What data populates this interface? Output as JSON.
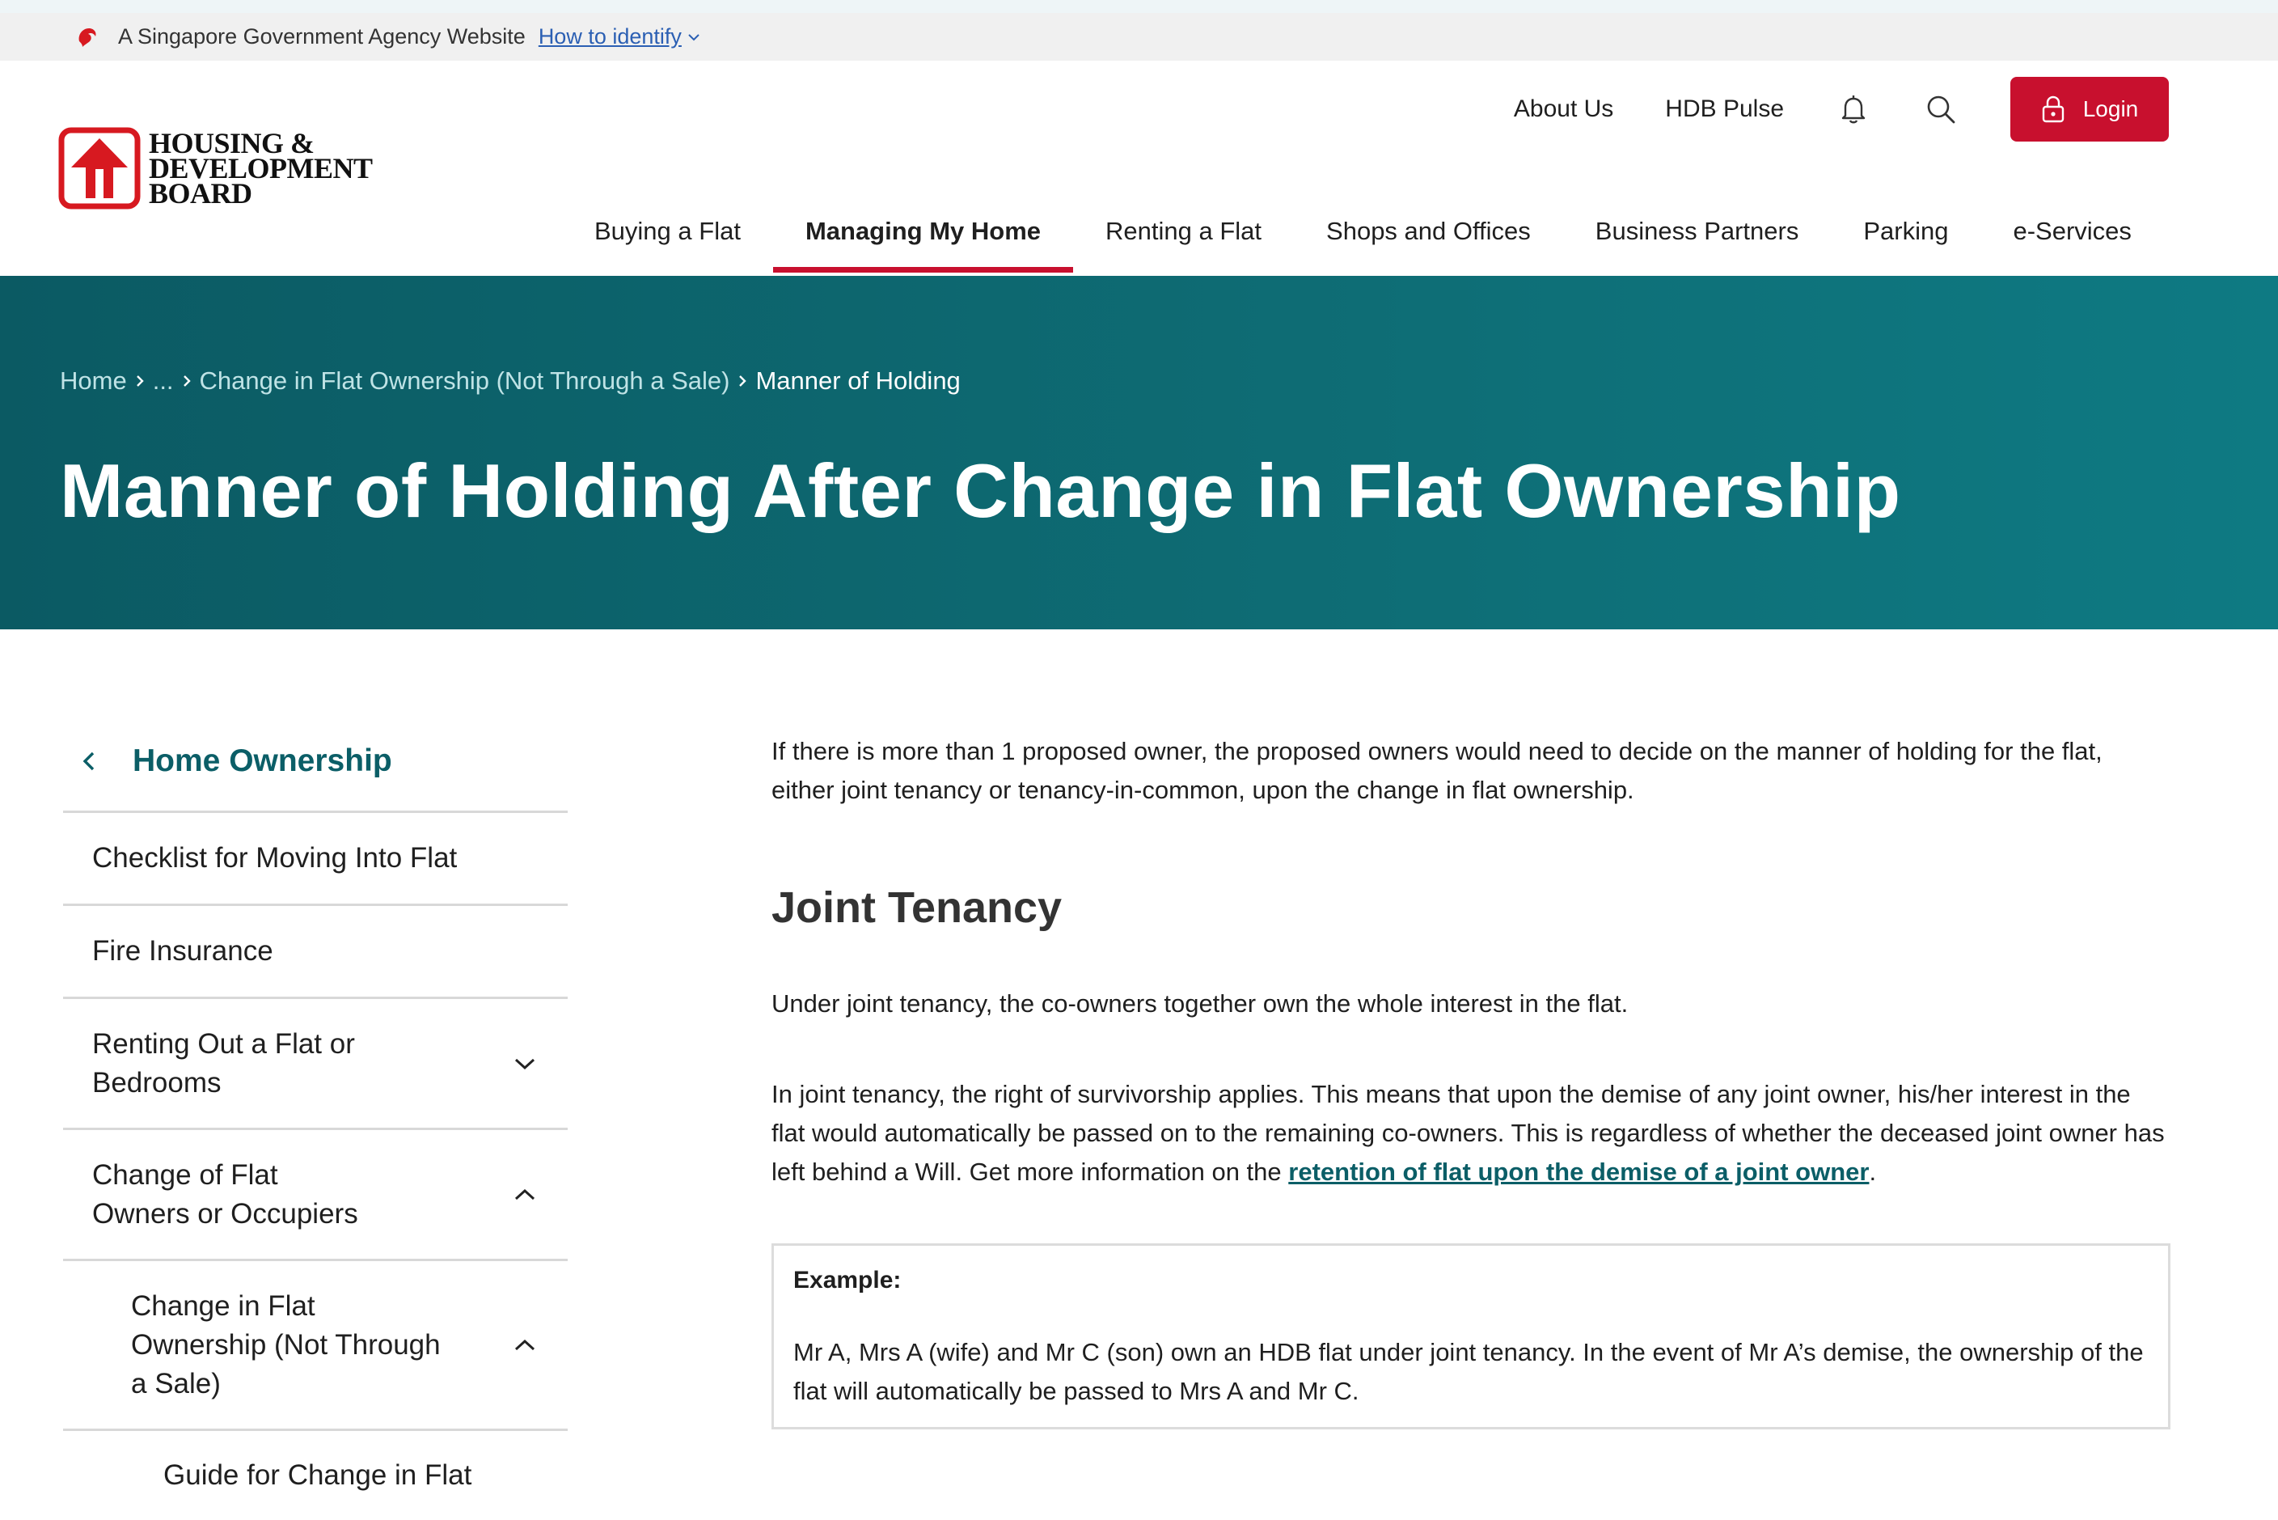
{
  "gov_bar": {
    "text": "A Singapore Government Agency Website",
    "link": "How to identify"
  },
  "logo": {
    "line1": "HOUSING &",
    "line2": "DEVELOPMENT",
    "line3": "BOARD"
  },
  "util_nav": {
    "about": "About Us",
    "pulse": "HDB Pulse",
    "login": "Login"
  },
  "main_nav": [
    {
      "label": "Buying a Flat",
      "active": false
    },
    {
      "label": "Managing My Home",
      "active": true
    },
    {
      "label": "Renting a Flat",
      "active": false
    },
    {
      "label": "Shops and Offices",
      "active": false
    },
    {
      "label": "Business Partners",
      "active": false
    },
    {
      "label": "Parking",
      "active": false
    },
    {
      "label": "e-Services",
      "active": false
    }
  ],
  "breadcrumb": {
    "home": "Home",
    "ellipsis": "...",
    "parent": "Change in Flat Ownership (Not Through a Sale)",
    "current": "Manner of Holding"
  },
  "page_title": "Manner of Holding After Change in Flat Ownership",
  "sidebar": {
    "title": "Home Ownership",
    "items": [
      {
        "line1": "Checklist for Moving Into Flat",
        "line2": ""
      },
      {
        "line1": "Fire Insurance",
        "line2": ""
      },
      {
        "line1": "Renting Out a Flat or",
        "line2": "Bedrooms"
      },
      {
        "line1": "Change of Flat",
        "line2": "Owners or Occupiers"
      },
      {
        "line1": "Change in Flat",
        "line2": "Ownership (Not Through",
        "line3": "a Sale)"
      },
      {
        "line1": "Guide for Change in Flat"
      }
    ]
  },
  "content": {
    "intro": "If there is more than 1 proposed owner, the proposed owners would need to decide on the manner of holding for the flat, either joint tenancy or tenancy-in-common, upon the change in flat ownership.",
    "heading": "Joint Tenancy",
    "p1": "Under joint tenancy, the co-owners together own the whole interest in the flat.",
    "p2_before": "In joint tenancy, the right of survivorship applies. This means that upon the demise of any joint owner, his/her interest in the flat would automatically be passed on to the remaining co-owners. This is regardless of whether the deceased joint owner has left behind a Will. Get more information on the ",
    "p2_link": "retention of flat upon the demise of a joint owner",
    "p2_after": ".",
    "example_label": "Example:",
    "example_text": "Mr A, Mrs A (wife) and Mr C (son) own an HDB flat under joint tenancy. In the event of Mr A’s demise, the ownership of the flat will automatically be passed to Mrs A and Mr C."
  },
  "colors": {
    "brand_red": "#c8102e",
    "teal": "#0b5e67",
    "hero_teal": "#0e6d75"
  },
  "icons": [
    "lion-head-icon",
    "chevron-down-icon",
    "bell-icon",
    "search-icon",
    "lock-icon",
    "chevron-right-icon",
    "chevron-left-icon",
    "chevron-up-icon"
  ]
}
